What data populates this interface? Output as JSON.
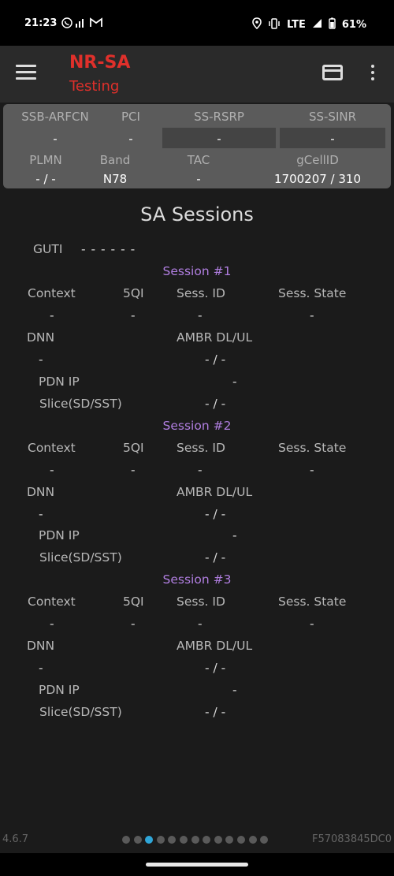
{
  "status_bar": {
    "time": "21:23",
    "carrier_icons": "✆ ⁷ᴵ ✉",
    "network": "LTE",
    "battery": "61%"
  },
  "app_bar": {
    "title": "NR-SA",
    "subtitle": "Testing"
  },
  "cell_info": {
    "ssb_arfcn_label": "SSB-ARFCN",
    "ssb_arfcn_value": "-",
    "pci_label": "PCI",
    "pci_value": "-",
    "ss_rsrp_label": "SS-RSRP",
    "ss_rsrp_value": "-",
    "ss_sinr_label": "SS-SINR",
    "ss_sinr_value": "-",
    "plmn_label": "PLMN",
    "plmn_value": "- / -",
    "band_label": "Band",
    "band_value": "N78",
    "tac_label": "TAC",
    "tac_value": "-",
    "gcellid_label": "gCellID",
    "gcellid_value": "1700207 / 310"
  },
  "sa_sessions": {
    "title": "SA Sessions",
    "guti_label": "GUTI",
    "guti_value": "- - - - - -",
    "sessions": [
      {
        "header": "Session #1",
        "context_label": "Context",
        "qi_label": "5QI",
        "sess_id_label": "Sess. ID",
        "sess_state_label": "Sess. State",
        "context_value": "-",
        "qi_value": "-",
        "sess_id_value": "-",
        "sess_state_value": "-",
        "dnn_label": "DNN",
        "ambr_label": "AMBR DL/UL",
        "dnn_value": "-",
        "ambr_value": "- / -",
        "pdn_ip_label": "PDN IP",
        "pdn_ip_value": "-",
        "slice_label": "Slice(SD/SST)",
        "slice_value": "- / -"
      },
      {
        "header": "Session #2",
        "context_label": "Context",
        "qi_label": "5QI",
        "sess_id_label": "Sess. ID",
        "sess_state_label": "Sess. State",
        "context_value": "-",
        "qi_value": "-",
        "sess_id_value": "-",
        "sess_state_value": "-",
        "dnn_label": "DNN",
        "ambr_label": "AMBR DL/UL",
        "dnn_value": "-",
        "ambr_value": "- / -",
        "pdn_ip_label": "PDN IP",
        "pdn_ip_value": "-",
        "slice_label": "Slice(SD/SST)",
        "slice_value": "- / -"
      },
      {
        "header": "Session #3",
        "context_label": "Context",
        "qi_label": "5QI",
        "sess_id_label": "Sess. ID",
        "sess_state_label": "Sess. State",
        "context_value": "-",
        "qi_value": "-",
        "sess_id_value": "-",
        "sess_state_value": "-",
        "dnn_label": "DNN",
        "ambr_label": "AMBR DL/UL",
        "dnn_value": "-",
        "ambr_value": "- / -",
        "pdn_ip_label": "PDN IP",
        "pdn_ip_value": "-",
        "slice_label": "Slice(SD/SST)",
        "slice_value": "- / -"
      }
    ]
  },
  "footer": {
    "version": "4.6.7",
    "device_id": "F57083845DC0",
    "page_count": 13,
    "active_page": 3
  },
  "colors": {
    "accent_red": "#e0302b",
    "session_purple": "#b07ee0",
    "active_dot": "#2fa6d8",
    "panel_bg": "#5b5b5b"
  },
  "icons": {
    "menu": "menu-icon",
    "card": "credit-card-icon",
    "more": "more-vert-icon",
    "location": "location-icon",
    "vibrate": "vibrate-icon",
    "signal": "signal-icon",
    "battery": "battery-icon"
  }
}
